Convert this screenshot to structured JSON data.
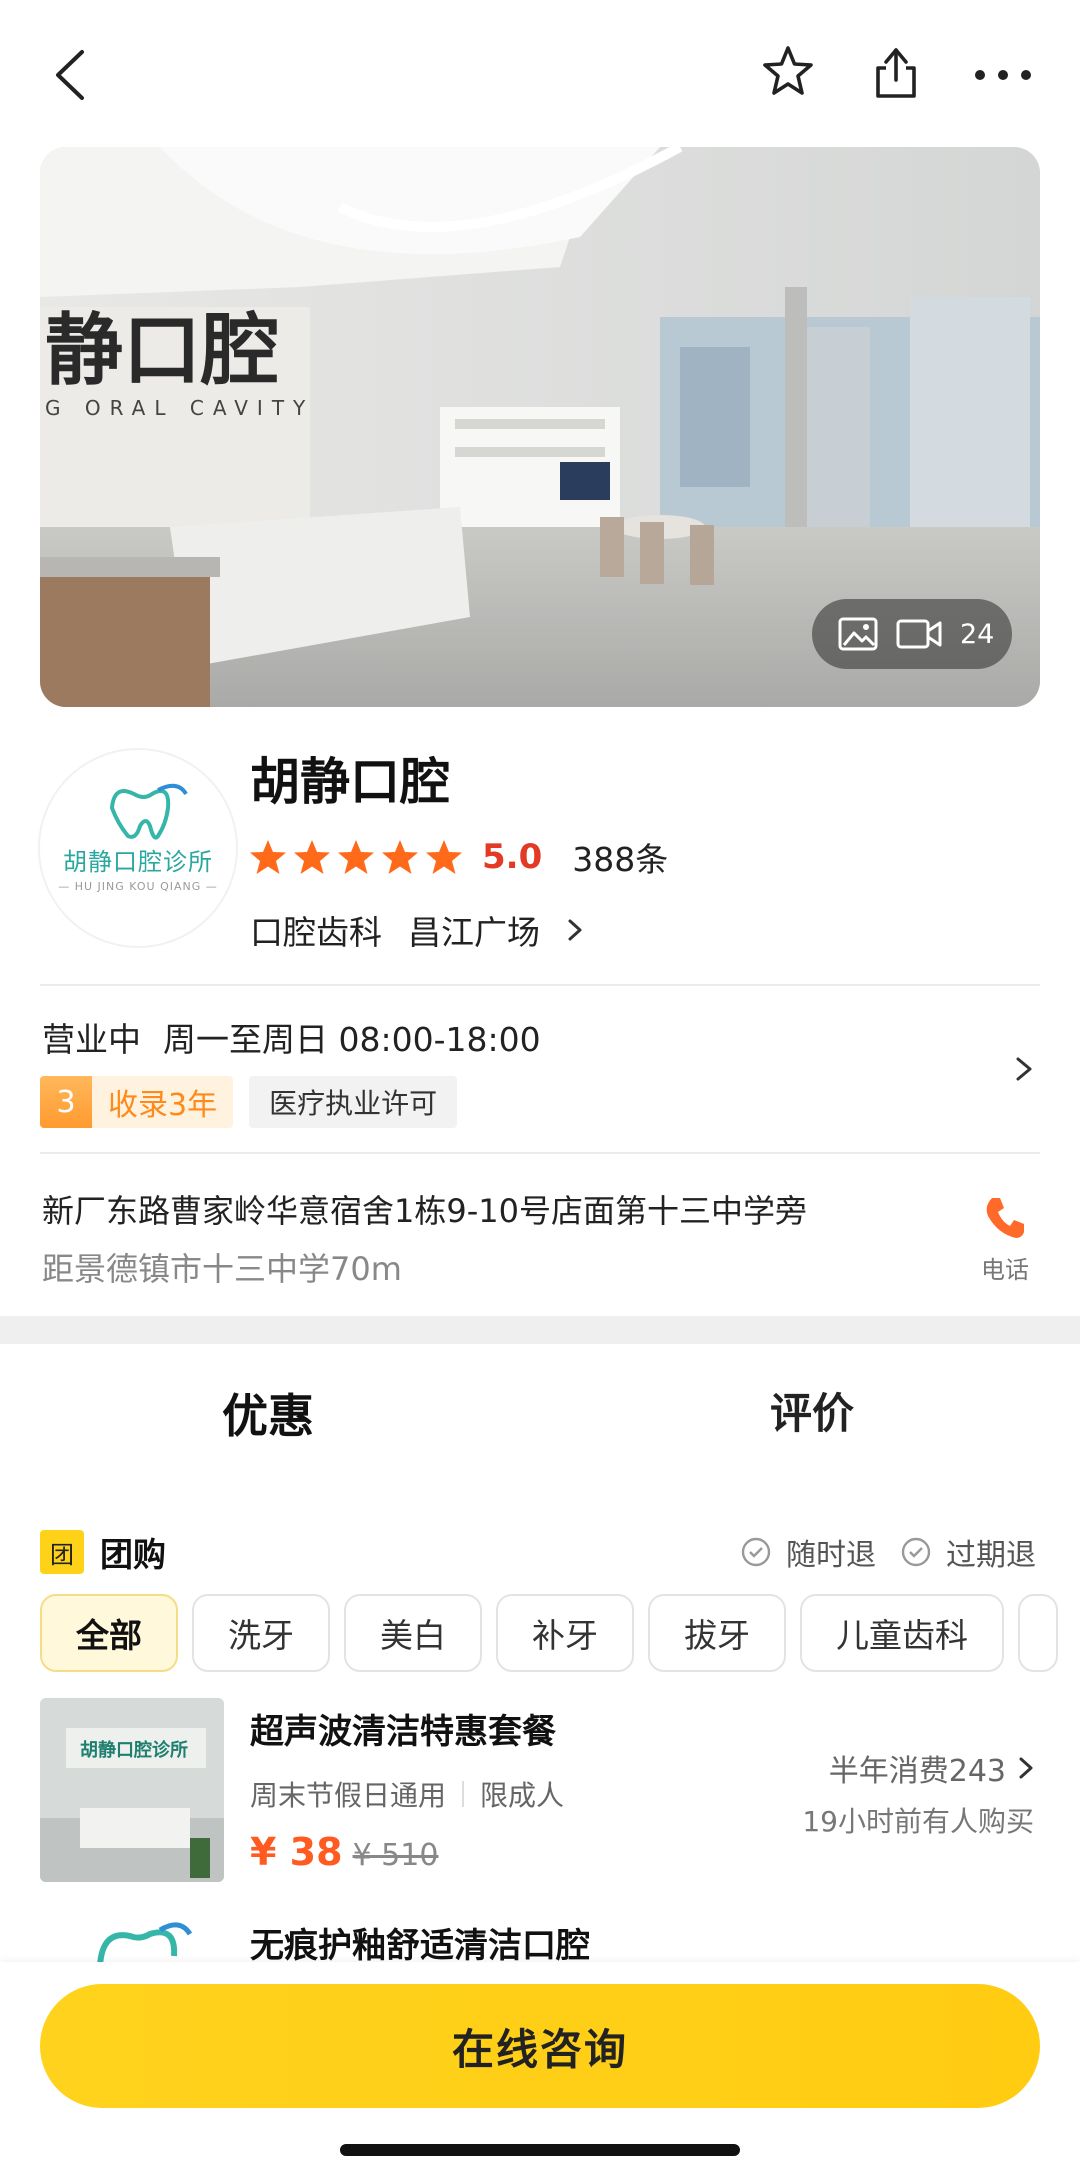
{
  "hero": {
    "media_count": "24"
  },
  "store": {
    "logo_text": "胡静口腔诊所",
    "logo_subtext": "— HU JING KOU QIANG —",
    "name": "胡静口腔",
    "rating": 5,
    "rating_label": "5.0",
    "review_count": "388条",
    "category": "口腔齿科",
    "area": "昌江广场"
  },
  "info": {
    "status": "营业中",
    "hours": "周一至周日 08:00-18:00",
    "tag_years_num": "3",
    "tag_years_text": "收录3年",
    "tag_license": "医疗执业许可",
    "address": "新厂东路曹家岭华意宿舍1栋9-10号店面第十三中学旁",
    "distance": "距景德镇市十三中学70m",
    "phone_label": "电话"
  },
  "tabs": [
    {
      "label": "优惠"
    },
    {
      "label": "评价"
    }
  ],
  "group_buy": {
    "badge": "团",
    "title": "团购",
    "refund_any": "随时退",
    "refund_expired": "过期退",
    "chips": [
      "全部",
      "洗牙",
      "美白",
      "补牙",
      "拔牙",
      "儿童齿科"
    ]
  },
  "deals": [
    {
      "img_text": "胡静口腔诊所",
      "title": "超声波清洁特惠套餐",
      "meta_1": "周末节假日通用",
      "meta_2": "限成人",
      "price_now": "¥ 38",
      "price_old": "¥ 510",
      "sales": "半年消费243",
      "recent": "19小时前有人购买"
    },
    {
      "title": "无痕护釉舒适清洁口腔"
    }
  ],
  "footer": {
    "consult_label": "在线咨询"
  },
  "colors": {
    "accent_yellow": "#ffd21a",
    "rating_red": "#e23a24",
    "star_orange": "#ff6a1a",
    "price_orange": "#ff5a1f"
  }
}
